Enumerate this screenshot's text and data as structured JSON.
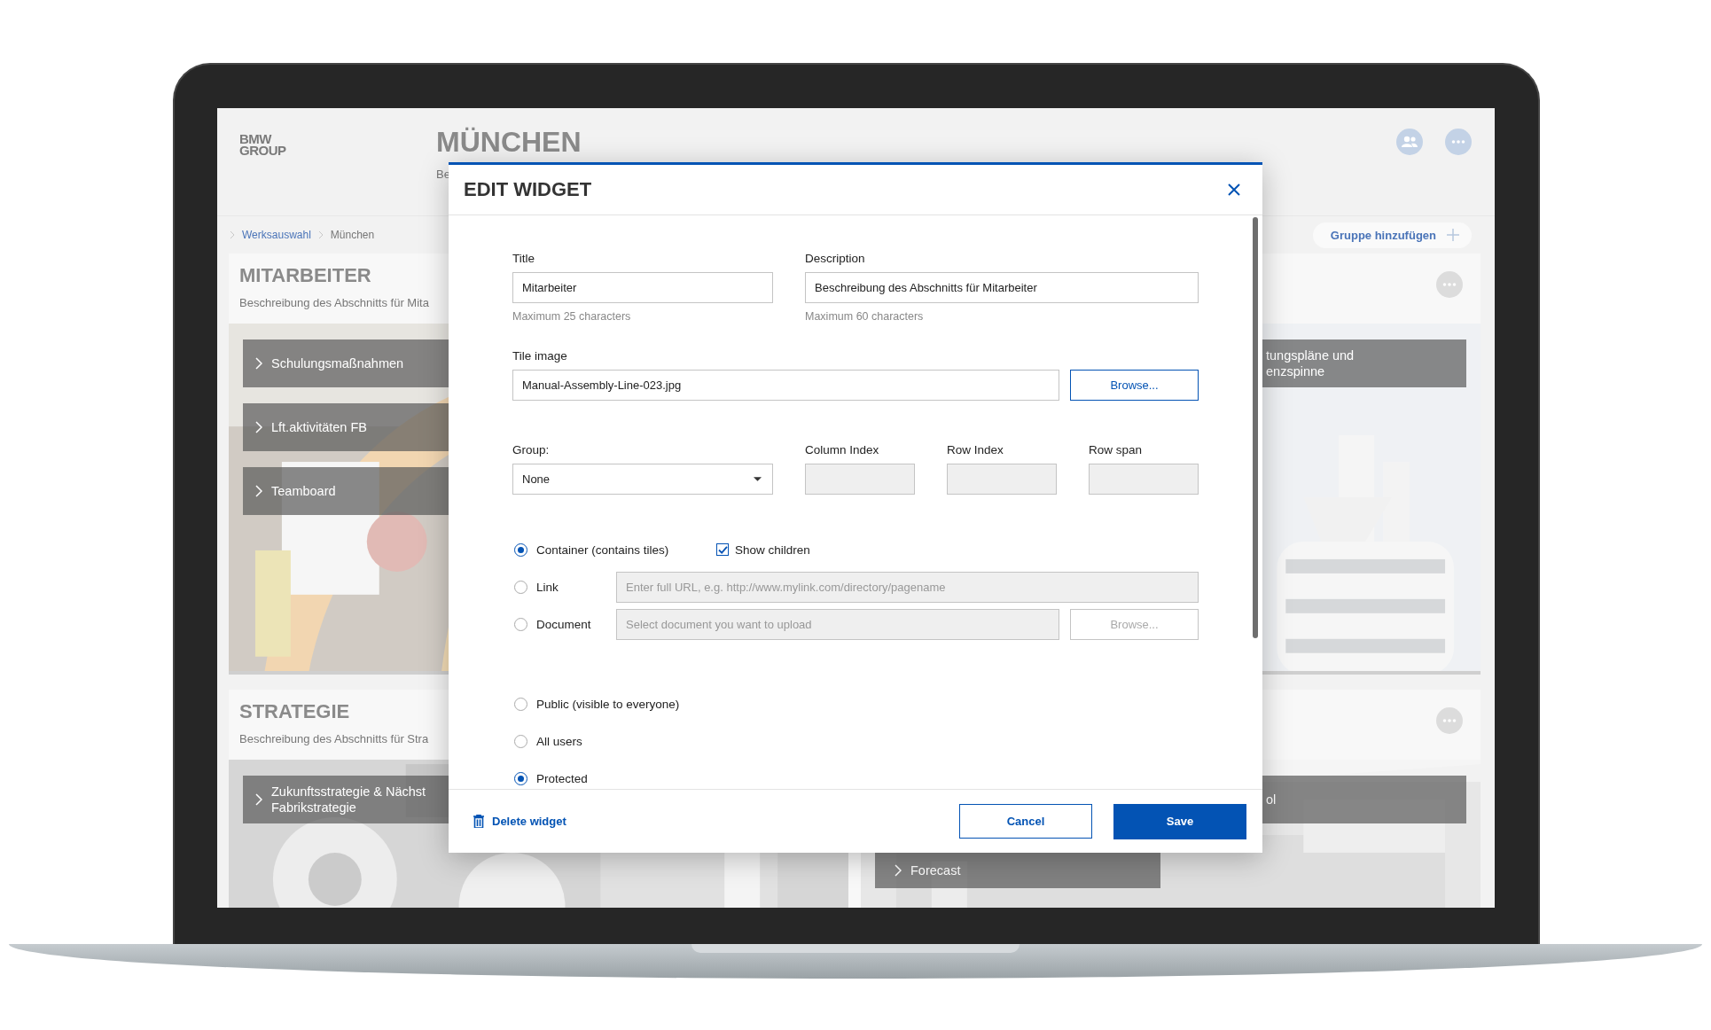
{
  "app": {
    "logo": "BMW\nGROUP",
    "title": "MÜNCHEN",
    "subtitle": "Be",
    "breadcrumb": [
      {
        "label": "Werksauswahl",
        "kind": "link"
      },
      {
        "label": "München",
        "kind": "current"
      }
    ],
    "add_group_button": "Gruppe hinzufügen",
    "sections": [
      {
        "title": "MITARBEITER",
        "description": "Beschreibung des Abschnitts für Mita",
        "columns": [
          {
            "tiles": [
              "Schulungsmaßnahmen",
              "Lft.aktivitäten FB",
              "Teamboard"
            ]
          },
          {
            "tiles": [
              "tungspläne und\nenzspinne"
            ]
          }
        ]
      },
      {
        "title": "STRATEGIE",
        "description": "Beschreibung des Abschnitts für Stra",
        "columns": [
          {
            "tiles": [
              "Zukunftsstrategie & Nächst\nFabrikstrategie"
            ]
          },
          {
            "tiles": [
              "ol",
              "Forecast"
            ]
          }
        ]
      }
    ]
  },
  "dialog": {
    "title": "EDIT WIDGET",
    "title_field": {
      "label": "Title",
      "value": "Mitarbeiter",
      "hint": "Maximum 25 characters"
    },
    "description_field": {
      "label": "Description",
      "value": "Beschreibung des Abschnitts für Mitarbeiter",
      "hint": "Maximum 60 characters"
    },
    "tile_image": {
      "label": "Tile image",
      "value": "Manual-Assembly-Line-023.jpg",
      "button": "Browse..."
    },
    "group": {
      "label": "Group:",
      "value": "None"
    },
    "index_fields": [
      {
        "label": "Column Index",
        "disabled": true
      },
      {
        "label": "Row Index",
        "disabled": true
      },
      {
        "label": "Row span",
        "disabled": true
      }
    ],
    "content_types": [
      {
        "kind": "container",
        "label": "Container (contains tiles)",
        "selected": true
      },
      {
        "kind": "link",
        "label": "Link",
        "selected": false,
        "placeholder": "Enter full URL, e.g. http://www.mylink.com/directory/pagename"
      },
      {
        "kind": "document",
        "label": "Document",
        "selected": false,
        "placeholder": "Select document you want to upload",
        "button": "Browse..."
      }
    ],
    "show_children": {
      "label": "Show children",
      "checked": true
    },
    "visibility": [
      {
        "label": "Public (visible to everyone)",
        "selected": false
      },
      {
        "label": "All users",
        "selected": false
      },
      {
        "label": "Protected",
        "selected": true
      }
    ],
    "delete_button": "Delete widget",
    "cancel_button": "Cancel",
    "save_button": "Save"
  }
}
